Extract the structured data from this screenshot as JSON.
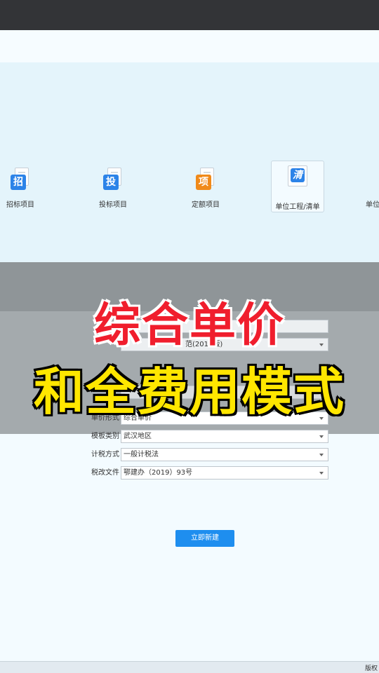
{
  "types": [
    {
      "badge": "招",
      "label": "招标项目",
      "color": "#2c83e8"
    },
    {
      "badge": "投",
      "label": "投标项目",
      "color": "#2c83e8"
    },
    {
      "badge": "项",
      "label": "定额项目",
      "color": "#f08a1a"
    },
    {
      "badge": "清",
      "label": "单位工程/清单",
      "color": "#2c83e8"
    },
    {
      "badge": "",
      "label": "单位",
      "color": "#2c83e8"
    }
  ],
  "form": {
    "hidden_field_2_value": "范(2018版)",
    "price_form_label": "单价形式",
    "price_form_value": "综合单价",
    "template_label": "模板类别",
    "template_value": "武汉地区",
    "tax_method_label": "计税方式",
    "tax_method_value": "一般计税法",
    "tax_file_label": "税改文件",
    "tax_file_value": "鄂建办（2019）93号"
  },
  "create_button_label": "立即新建",
  "banner": {
    "line1": "综合单价",
    "line2": "和全费用模式"
  },
  "footer_text": "版权"
}
